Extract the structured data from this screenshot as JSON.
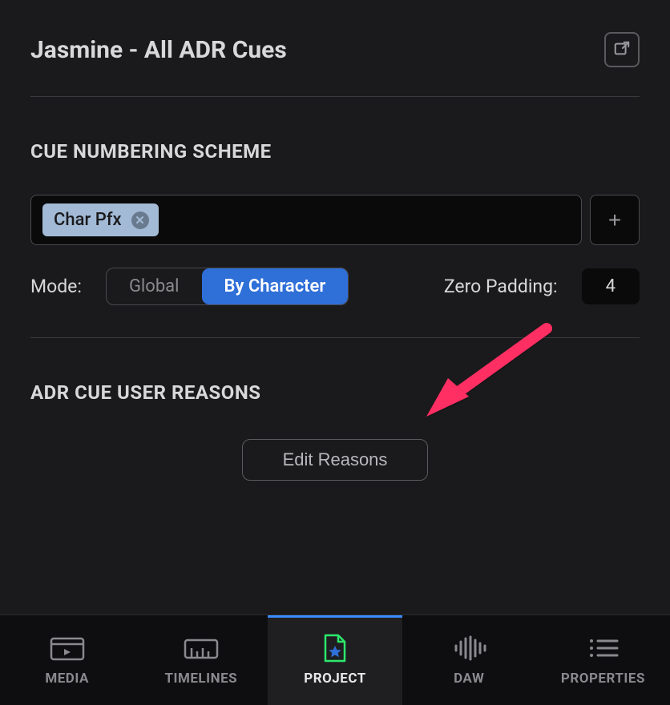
{
  "header": {
    "title": "Jasmine - All ADR Cues"
  },
  "sections": {
    "cueNumbering": {
      "heading": "CUE NUMBERING SCHEME",
      "chip": "Char Pfx",
      "modeLabel": "Mode:",
      "modeOptions": {
        "global": "Global",
        "byCharacter": "By Character"
      },
      "paddingLabel": "Zero Padding:",
      "paddingValue": "4"
    },
    "adrReasons": {
      "heading": "ADR CUE USER REASONS",
      "editButton": "Edit Reasons"
    }
  },
  "tabs": {
    "media": "MEDIA",
    "timelines": "TIMELINES",
    "project": "PROJECT",
    "daw": "DAW",
    "properties": "PROPERTIES"
  }
}
